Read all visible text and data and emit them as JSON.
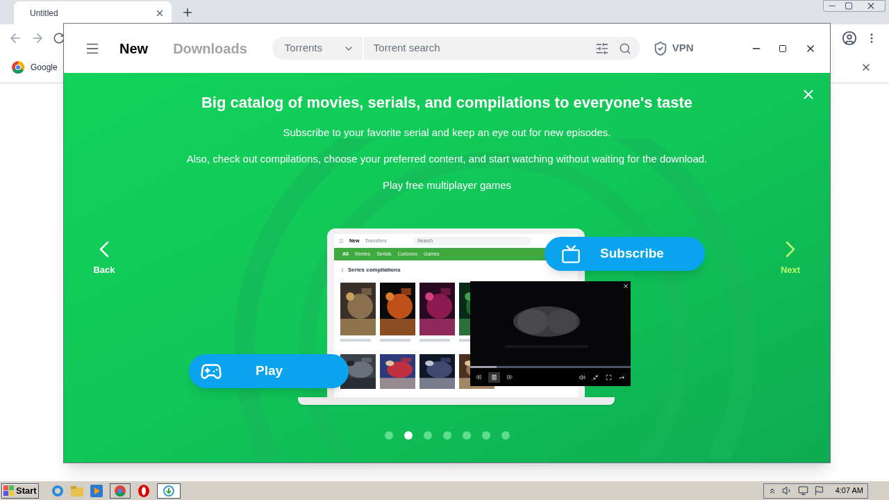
{
  "browser": {
    "tab_title": "Untitled",
    "bookmark": "Google"
  },
  "app": {
    "nav": [
      {
        "label": "New",
        "selected": true
      },
      {
        "label": "Downloads",
        "selected": false
      }
    ],
    "search": {
      "category": "Torrents",
      "placeholder": "Torrent search"
    },
    "vpn": "VPN"
  },
  "slide": {
    "title": "Big catalog of movies, serials, and compilations to everyone's taste",
    "paragraphs": [
      "Subscribe to your favorite serial and keep an eye out for new episodes.",
      "Also, check out compilations, choose your preferred content, and start watching without waiting for the download.",
      "Play free multiplayer games"
    ],
    "back": "Back",
    "next": "Next",
    "dots": [
      {
        "selected": false
      },
      {
        "selected": true
      },
      {
        "selected": false
      },
      {
        "selected": false
      },
      {
        "selected": false
      },
      {
        "selected": false
      },
      {
        "selected": false
      }
    ],
    "illustration": {
      "nav": [
        {
          "label": "New",
          "selected": true
        },
        {
          "label": "Transfers",
          "selected": false
        }
      ],
      "search_placeholder": "Search",
      "categories": [
        {
          "label": "All",
          "selected": true
        },
        {
          "label": "Movies",
          "selected": false
        },
        {
          "label": "Serials",
          "selected": false
        },
        {
          "label": "Cartoons",
          "selected": false
        },
        {
          "label": "Games",
          "selected": false
        }
      ],
      "section": "Series compilations",
      "subscribe": "Subscribe",
      "play": "Play"
    }
  },
  "taskbar": {
    "start": "Start",
    "clock": "4:07 AM"
  }
}
